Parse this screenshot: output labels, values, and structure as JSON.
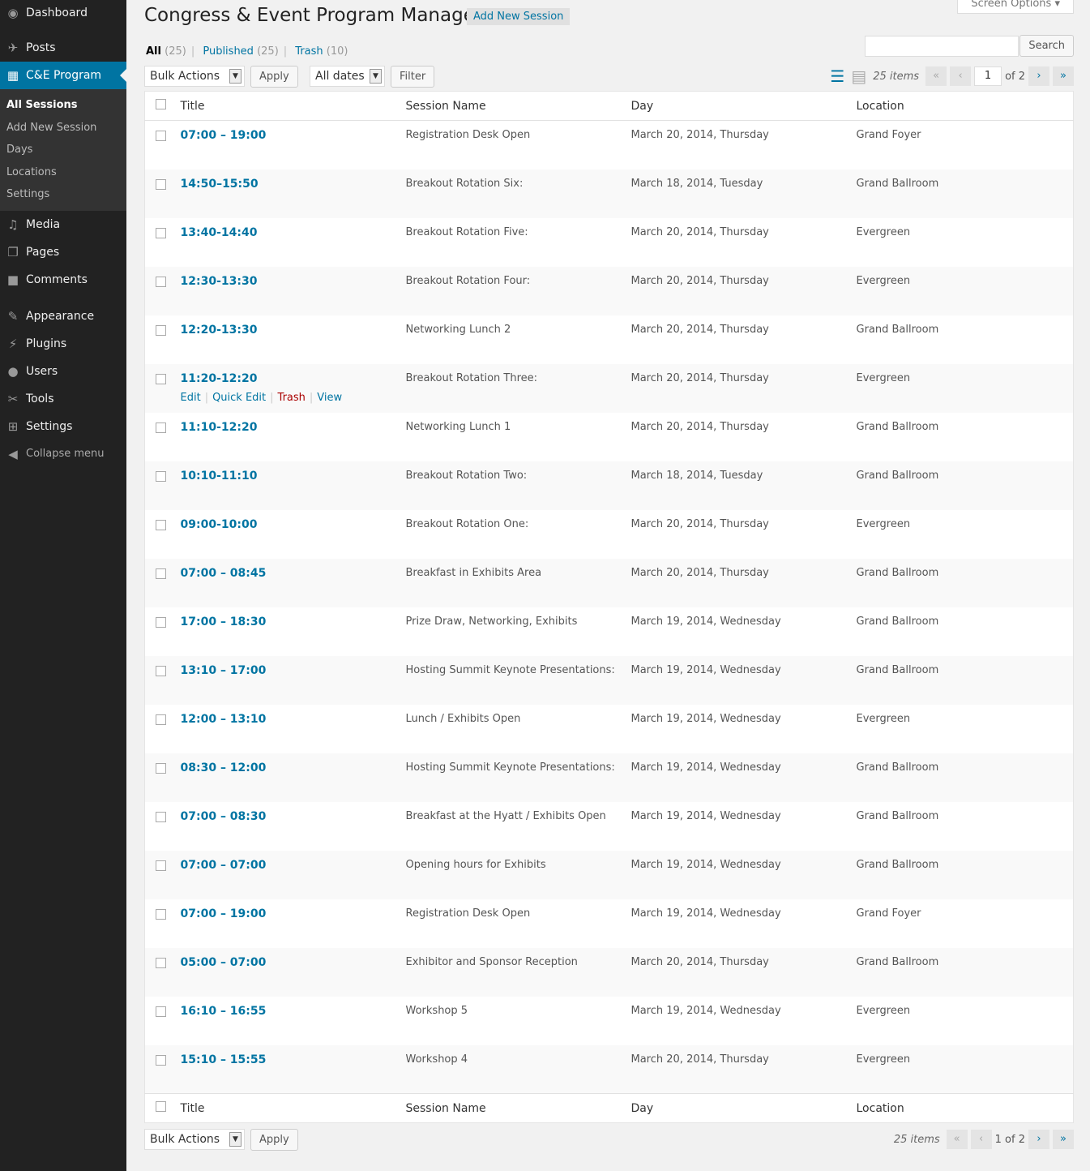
{
  "sidebar": {
    "items": [
      {
        "label": "Dashboard",
        "icon": "dashboard-icon"
      },
      {
        "label": "Posts",
        "icon": "pin-icon"
      },
      {
        "label": "C&E Program",
        "icon": "calendar-icon"
      },
      {
        "label": "Media",
        "icon": "media-icon"
      },
      {
        "label": "Pages",
        "icon": "pages-icon"
      },
      {
        "label": "Comments",
        "icon": "comment-icon"
      },
      {
        "label": "Appearance",
        "icon": "brush-icon"
      },
      {
        "label": "Plugins",
        "icon": "plugin-icon"
      },
      {
        "label": "Users",
        "icon": "user-icon"
      },
      {
        "label": "Tools",
        "icon": "wrench-icon"
      },
      {
        "label": "Settings",
        "icon": "settings-icon"
      }
    ],
    "submenu": [
      "All Sessions",
      "Add New Session",
      "Days",
      "Locations",
      "Settings"
    ],
    "collapse": "Collapse menu"
  },
  "header": {
    "title": "Congress & Event Program Manager",
    "add_new": "Add New Session",
    "screen_options": "Screen Options"
  },
  "filters": {
    "all": "All",
    "all_count": "(25)",
    "published": "Published",
    "published_count": "(25)",
    "trash": "Trash",
    "trash_count": "(10)"
  },
  "toolbar": {
    "search_button": "Search",
    "search_value": "",
    "bulk_actions": "Bulk Actions",
    "apply": "Apply",
    "all_dates": "All dates",
    "filter": "Filter",
    "items": "25 items",
    "page": "1",
    "of_pages": "of 2",
    "page_text": "1 of 2",
    "first": "«",
    "prev": "‹",
    "next": "›",
    "last": "»"
  },
  "columns": [
    "Title",
    "Session Name",
    "Day",
    "Location"
  ],
  "row_actions": {
    "edit": "Edit",
    "quick_edit": "Quick Edit",
    "trash": "Trash",
    "view": "View"
  },
  "rows": [
    [
      "07:00 – 19:00",
      "Registration Desk Open",
      "March 20, 2014, Thursday",
      "Grand Foyer"
    ],
    [
      "14:50–15:50",
      "Breakout Rotation Six:",
      "March 18, 2014, Tuesday",
      "Grand Ballroom"
    ],
    [
      "13:40-14:40",
      "Breakout Rotation Five:",
      "March 20, 2014, Thursday",
      "Evergreen"
    ],
    [
      "12:30-13:30",
      "Breakout Rotation Four:",
      "March 20, 2014, Thursday",
      "Evergreen"
    ],
    [
      "12:20-13:30",
      "Networking Lunch 2",
      "March 20, 2014, Thursday",
      "Grand Ballroom"
    ],
    [
      "11:20-12:20",
      "Breakout Rotation Three:",
      "March 20, 2014, Thursday",
      "Evergreen"
    ],
    [
      "11:10-12:20",
      "Networking Lunch 1",
      "March 20, 2014, Thursday",
      "Grand Ballroom"
    ],
    [
      "10:10-11:10",
      "Breakout Rotation Two:",
      "March 18, 2014, Tuesday",
      "Grand Ballroom"
    ],
    [
      "09:00-10:00",
      "Breakout Rotation One:",
      "March 20, 2014, Thursday",
      "Evergreen"
    ],
    [
      "07:00 – 08:45",
      "Breakfast in Exhibits Area",
      "March 20, 2014, Thursday",
      "Grand Ballroom"
    ],
    [
      "17:00 – 18:30",
      "Prize Draw, Networking, Exhibits",
      "March 19, 2014, Wednesday",
      "Grand Ballroom"
    ],
    [
      "13:10 – 17:00",
      "Hosting Summit Keynote Presentations:",
      "March 19, 2014, Wednesday",
      "Grand Ballroom"
    ],
    [
      "12:00 – 13:10",
      "Lunch / Exhibits Open",
      "March 19, 2014, Wednesday",
      "Evergreen"
    ],
    [
      "08:30 – 12:00",
      "Hosting Summit Keynote Presentations:",
      "March 19, 2014, Wednesday",
      "Grand Ballroom"
    ],
    [
      "07:00 – 08:30",
      "Breakfast at the Hyatt / Exhibits Open",
      "March 19, 2014, Wednesday",
      "Grand Ballroom"
    ],
    [
      "07:00 – 07:00",
      "Opening hours for Exhibits",
      "March 19, 2014, Wednesday",
      "Grand Ballroom"
    ],
    [
      "07:00 – 19:00",
      "Registration Desk Open",
      "March 19, 2014, Wednesday",
      "Grand Foyer"
    ],
    [
      "05:00 – 07:00",
      "Exhibitor and Sponsor Reception",
      "March 20, 2014, Thursday",
      "Grand Ballroom"
    ],
    [
      "16:10 – 16:55",
      "Workshop 5",
      "March 19, 2014, Wednesday",
      "Evergreen"
    ],
    [
      "15:10 – 15:55",
      "Workshop 4",
      "March 20, 2014, Thursday",
      "Evergreen"
    ]
  ],
  "colors": {
    "accent": "#0074a2",
    "sidebar": "#222222",
    "trash": "#aa0000"
  }
}
